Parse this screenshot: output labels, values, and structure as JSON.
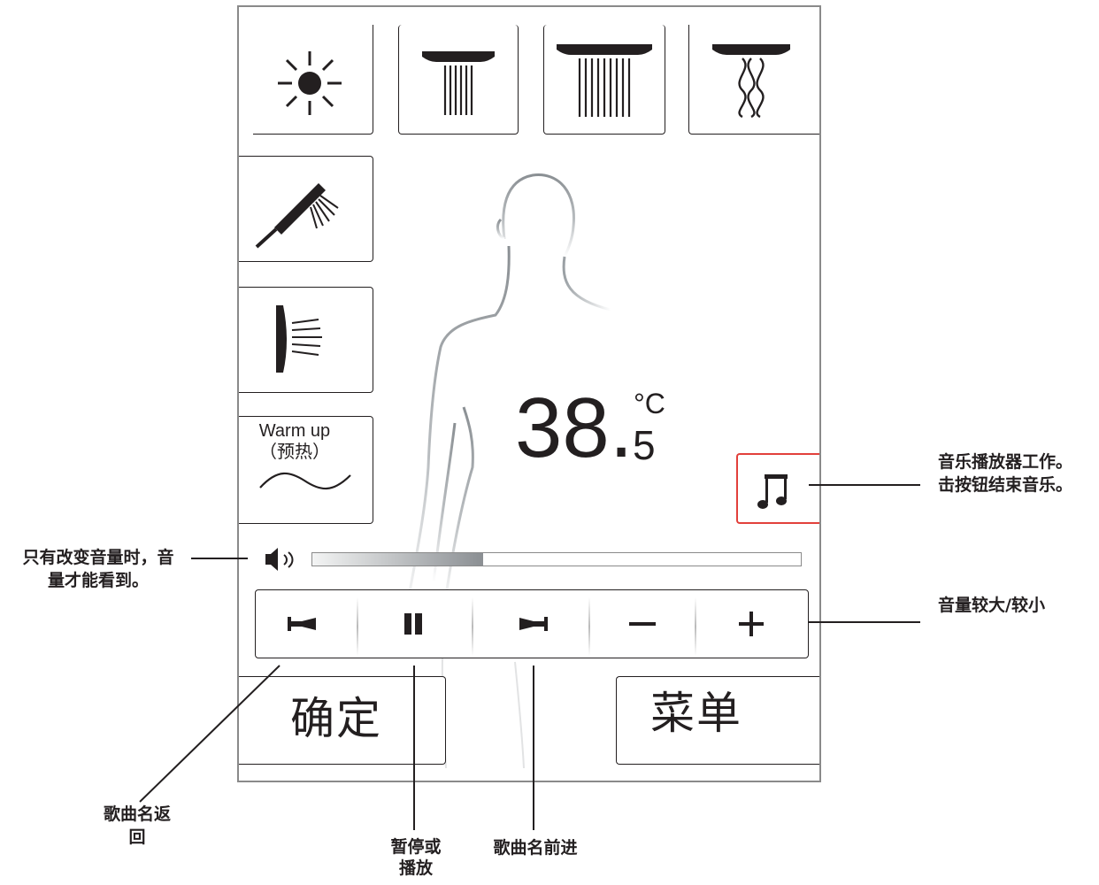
{
  "temperature": {
    "main": "38.",
    "decimal": "5",
    "unit": "°C"
  },
  "warm_up": {
    "line1": "Warm up",
    "line2": "（预热）"
  },
  "buttons": {
    "confirm": "确定",
    "menu": "菜单"
  },
  "volume": {
    "level": 0.35
  },
  "icons": {
    "light": "sun-icon",
    "shower_narrow": "rain-shower-narrow-icon",
    "shower_wide": "rain-shower-wide-icon",
    "shower_waterfall": "waterfall-shower-icon",
    "hand_shower": "hand-shower-icon",
    "side_jets": "side-jets-icon",
    "music": "music-note-icon",
    "speaker": "speaker-icon",
    "prev": "previous-track-icon",
    "pause": "pause-icon",
    "next": "next-track-icon",
    "minus": "minus-icon",
    "plus": "plus-icon"
  },
  "colors": {
    "music_button_border": "#e2403b",
    "volume_fill": "#8b8f93"
  },
  "annotations": {
    "music_player_l1": "音乐播放器工作。",
    "music_player_l2": "击按钮结束音乐。",
    "volume_visible_l1": "只有改变音量时，音",
    "volume_visible_l2": "量才能看到。",
    "volume_adjust": "音量较大/较小",
    "prev_l1": "歌曲名返",
    "prev_l2": "回",
    "pause_l1": "暂停或",
    "pause_l2": "播放",
    "next": "歌曲名前进"
  }
}
